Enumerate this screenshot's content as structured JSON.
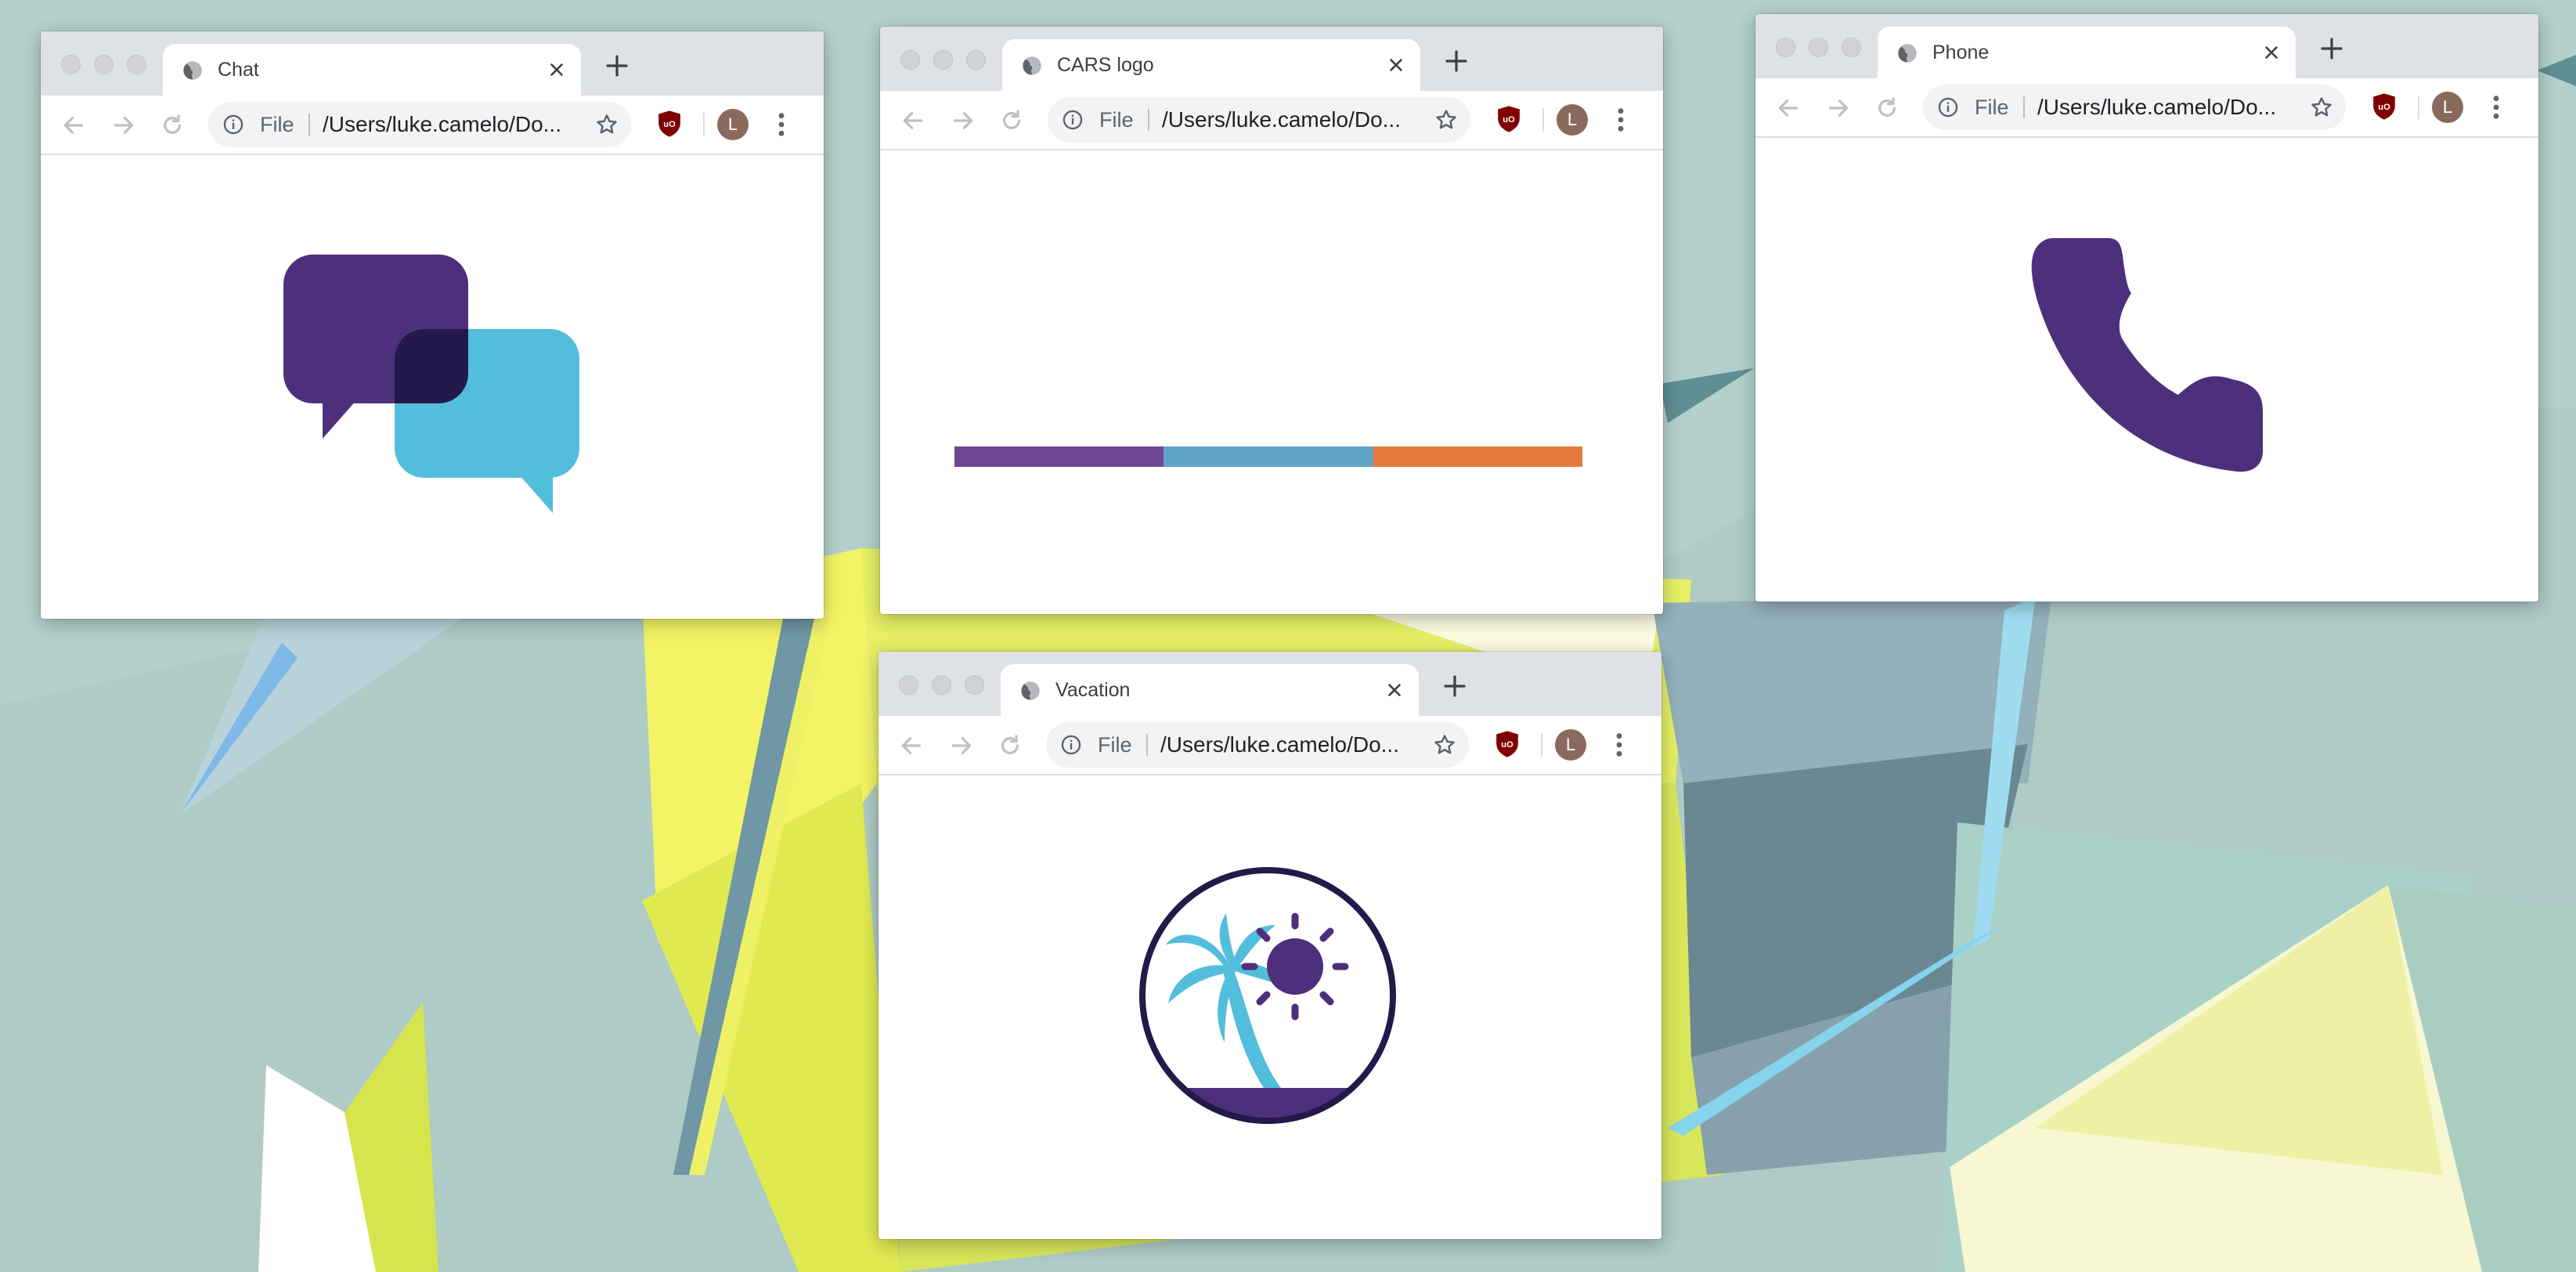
{
  "windows": [
    {
      "tab_title": "Chat",
      "file_label": "File",
      "url": "/Users/luke.camelo/Do...",
      "avatar_initial": "L",
      "content": "chat-icon"
    },
    {
      "tab_title": "CARS logo",
      "file_label": "File",
      "url": "/Users/luke.camelo/Do...",
      "avatar_initial": "L",
      "content": "cars-logo"
    },
    {
      "tab_title": "Phone",
      "file_label": "File",
      "url": "/Users/luke.camelo/Do...",
      "avatar_initial": "L",
      "content": "phone-icon"
    },
    {
      "tab_title": "Vacation",
      "file_label": "File",
      "url": "/Users/luke.camelo/Do...",
      "avatar_initial": "L",
      "content": "vacation-icon"
    }
  ],
  "colors": {
    "purple": "#4e2f7c",
    "cyan": "#53bedb",
    "navy": "#23194a",
    "logo_purple": "#6e4792",
    "logo_blue": "#5ea3c8",
    "logo_orange": "#e57a3a",
    "ublock_red": "#800000"
  }
}
